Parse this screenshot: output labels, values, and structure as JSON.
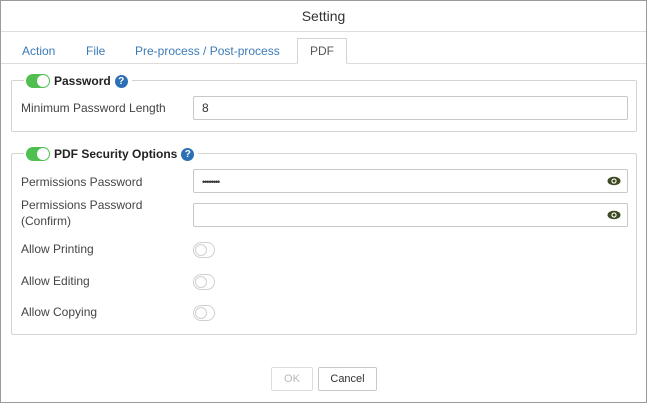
{
  "dialog": {
    "title": "Setting"
  },
  "tabs": [
    {
      "label": "Action"
    },
    {
      "label": "File"
    },
    {
      "label": "Pre-process / Post-process"
    },
    {
      "label": "PDF",
      "active": true
    }
  ],
  "password_section": {
    "enabled": true,
    "title": "Password",
    "help_icon": "?",
    "min_length_label": "Minimum Password Length",
    "min_length_value": "8"
  },
  "security_section": {
    "enabled": true,
    "title": "PDF Security Options",
    "help_icon": "?",
    "permissions_password_label": "Permissions Password",
    "permissions_password_value": "••••••••",
    "confirm_label_line1": "Permissions Password",
    "confirm_label_line2": "(Confirm)",
    "confirm_value": "",
    "allow_printing_label": "Allow Printing",
    "allow_printing": false,
    "allow_editing_label": "Allow Editing",
    "allow_editing": false,
    "allow_copying_label": "Allow Copying",
    "allow_copying": false
  },
  "footer": {
    "ok_label": "OK",
    "cancel_label": "Cancel"
  },
  "colors": {
    "toggle_on": "#4fc04f",
    "tab_link": "#3a7bb7",
    "help_icon": "#2c6fb4",
    "eye_icon": "#3d4a22"
  }
}
